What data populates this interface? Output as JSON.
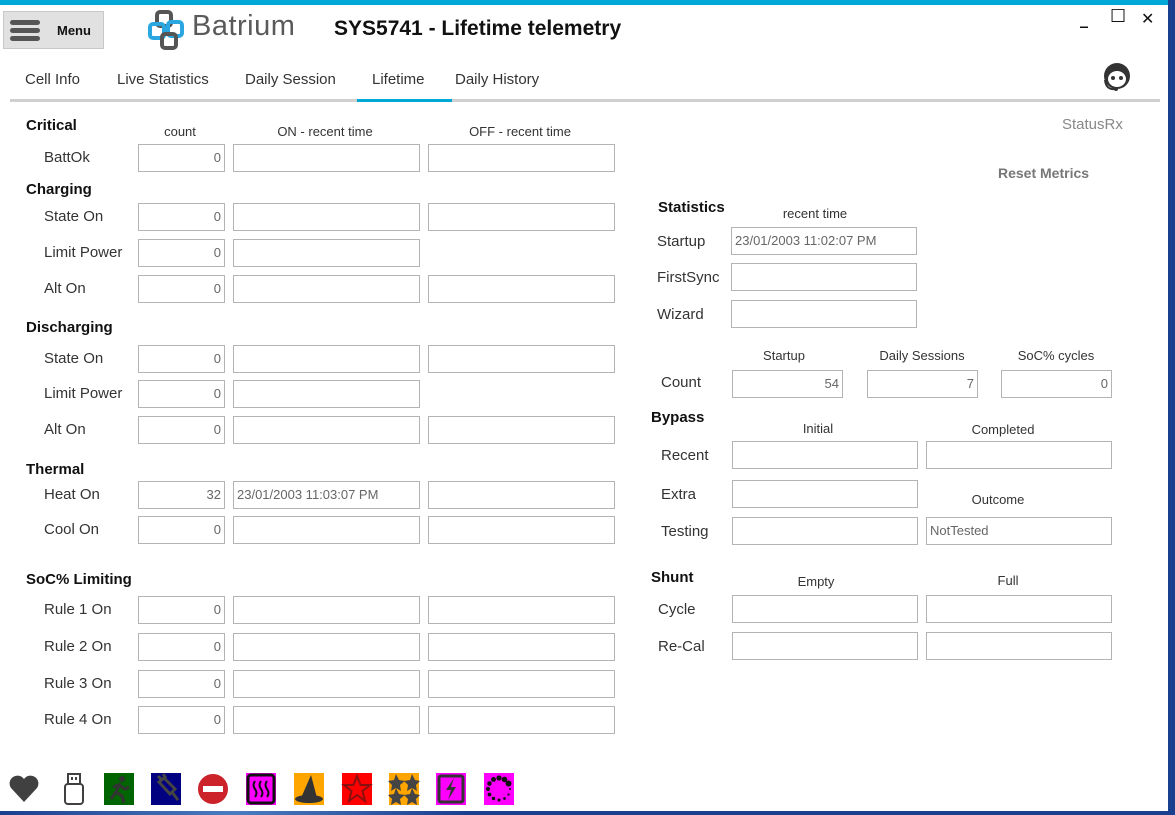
{
  "app": {
    "menu_label": "Menu",
    "brand": "Batrium",
    "title": "SYS5741 - Lifetime telemetry",
    "status": "StatusRx",
    "reset_label": "Reset Metrics"
  },
  "window": {
    "minimize": "_",
    "maximize": "☐",
    "close": "✕"
  },
  "tabs": [
    {
      "label": "Cell Info"
    },
    {
      "label": "Live Statistics"
    },
    {
      "label": "Daily Session"
    },
    {
      "label": "Lifetime",
      "active": true
    },
    {
      "label": "Daily History"
    }
  ],
  "left": {
    "columns": {
      "count": "count",
      "on": "ON - recent time",
      "off": "OFF - recent time"
    },
    "sections": [
      {
        "title": "Critical",
        "rows": [
          {
            "label": "BattOk",
            "count": "0",
            "on": "",
            "off": ""
          }
        ]
      },
      {
        "title": "Charging",
        "rows": [
          {
            "label": "State On",
            "count": "0",
            "on": "",
            "off": ""
          },
          {
            "label": "Limit Power",
            "count": "0",
            "on": ""
          },
          {
            "label": "Alt On",
            "count": "0",
            "on": "",
            "off": ""
          }
        ]
      },
      {
        "title": "Discharging",
        "rows": [
          {
            "label": "State On",
            "count": "0",
            "on": "",
            "off": ""
          },
          {
            "label": "Limit Power",
            "count": "0",
            "on": ""
          },
          {
            "label": "Alt On",
            "count": "0",
            "on": "",
            "off": ""
          }
        ]
      },
      {
        "title": "Thermal",
        "rows": [
          {
            "label": "Heat On",
            "count": "32",
            "on": "23/01/2003 11:03:07 PM",
            "off": ""
          },
          {
            "label": "Cool On",
            "count": "0",
            "on": "",
            "off": ""
          }
        ]
      },
      {
        "title": "SoC% Limiting",
        "rows": [
          {
            "label": "Rule 1 On",
            "count": "0",
            "on": "",
            "off": ""
          },
          {
            "label": "Rule 2 On",
            "count": "0",
            "on": "",
            "off": ""
          },
          {
            "label": "Rule 3 On",
            "count": "0",
            "on": "",
            "off": ""
          },
          {
            "label": "Rule 4 On",
            "count": "0",
            "on": "",
            "off": ""
          }
        ]
      }
    ]
  },
  "statistics": {
    "title": "Statistics",
    "col": "recent time",
    "rows": [
      {
        "label": "Startup",
        "value": "23/01/2003 11:02:07 PM"
      },
      {
        "label": "FirstSync",
        "value": ""
      },
      {
        "label": "Wizard",
        "value": ""
      }
    ]
  },
  "count": {
    "label": "Count",
    "cols": [
      "Startup",
      "Daily Sessions",
      "SoC% cycles"
    ],
    "values": [
      "54",
      "7",
      "0"
    ]
  },
  "bypass": {
    "title": "Bypass",
    "col_initial": "Initial",
    "col_completed": "Completed",
    "col_outcome": "Outcome",
    "rows": [
      {
        "label": "Recent",
        "initial": "",
        "completed": ""
      },
      {
        "label": "Extra",
        "initial": ""
      },
      {
        "label": "Testing",
        "initial": "",
        "outcome": "NotTested"
      }
    ]
  },
  "shunt": {
    "title": "Shunt",
    "col_empty": "Empty",
    "col_full": "Full",
    "rows": [
      {
        "label": "Cycle",
        "empty": "",
        "full": ""
      },
      {
        "label": "Re-Cal",
        "empty": "",
        "full": ""
      }
    ]
  },
  "status_icons": [
    {
      "name": "heart-icon",
      "color": "#404040"
    },
    {
      "name": "usb-icon",
      "color": "#404040"
    },
    {
      "name": "running-man-icon",
      "color": "#006400"
    },
    {
      "name": "unplugged-icon",
      "color": "#000080"
    },
    {
      "name": "no-entry-icon",
      "color": "#cc2229"
    },
    {
      "name": "heater-icon",
      "color": "#ff00ff"
    },
    {
      "name": "wizard-hat-icon",
      "color": "#ffa500"
    },
    {
      "name": "star-icon",
      "color": "#ff0000"
    },
    {
      "name": "stars-icon",
      "color": "#ffa500"
    },
    {
      "name": "lightning-icon",
      "color": "#ff00ff"
    },
    {
      "name": "spinner-dots-icon",
      "color": "#ff00ff"
    }
  ]
}
